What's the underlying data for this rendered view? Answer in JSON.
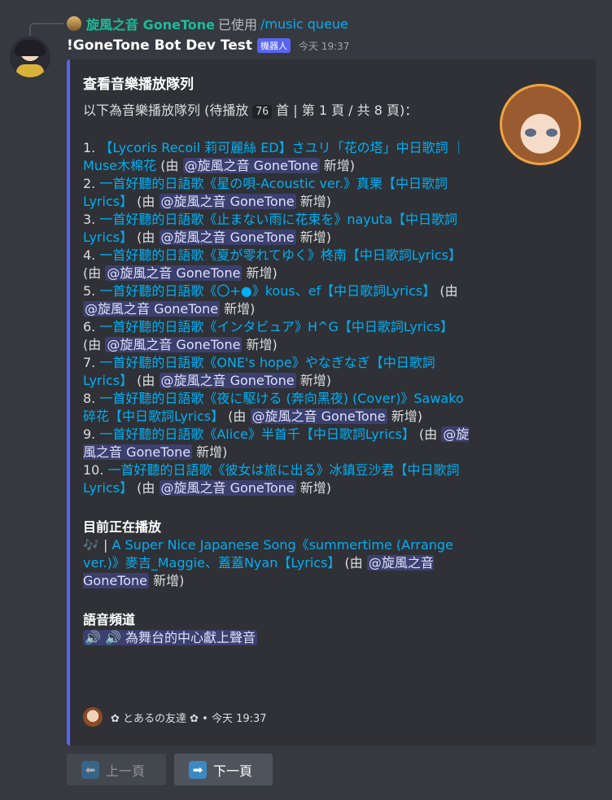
{
  "reply": {
    "user": "旋風之音 GoneTone",
    "used": "已使用",
    "command": "/music queue"
  },
  "message": {
    "bot_name": "!GoneTone Bot Dev Test",
    "bot_tag": "機器人",
    "timestamp": "今天 19:37"
  },
  "embed": {
    "title": "查看音樂播放隊列",
    "desc_prefix": "以下為音樂播放隊列 (待播放 ",
    "pending_count": "76",
    "desc_suffix": " 首 | 第 1 頁 / 共 8 頁)：",
    "mention_prefix": "@",
    "mention_name": "旋風之音 GoneTone",
    "added_by_open": "(由 ",
    "added_by_close": " 新增)",
    "queue": [
      {
        "num": "1.",
        "title": "【Lycoris Recoil 莉可麗絲 ED】さユリ「花の塔」中日歌詞 ｜Muse木棉花"
      },
      {
        "num": "2.",
        "title": "一首好聽的日語歌《星の唄-Acoustic ver.》真栗【中日歌詞Lyrics】"
      },
      {
        "num": "3.",
        "title": "一首好聽的日語歌《止まない雨に花束を》nayuta【中日歌詞Lyrics】"
      },
      {
        "num": "4.",
        "title": "一首好聽的日語歌《夏が零れてゆく》柊南【中日歌詞Lyrics】"
      },
      {
        "num": "5.",
        "title": "一首好聽的日語歌《〇+●》kous、ef【中日歌詞Lyrics】"
      },
      {
        "num": "6.",
        "title": "一首好聽的日語歌《インタビュア》H^G【中日歌詞Lyrics】"
      },
      {
        "num": "7.",
        "title": "一首好聽的日語歌《ONE's hope》やなぎなぎ【中日歌詞Lyrics】"
      },
      {
        "num": "8.",
        "title": "一首好聽的日語歌《夜に駆ける (奔向黑夜) (Cover)》Sawako碎花【中日歌詞Lyrics】"
      },
      {
        "num": "9.",
        "title": "一首好聽的日語歌《Alice》半首千【中日歌詞Lyrics】"
      },
      {
        "num": "10.",
        "title": "一首好聽的日語歌《彼女は旅に出る》冰鎮豆沙君【中日歌詞Lyrics】"
      }
    ],
    "now_playing_title": "目前正在播放",
    "now_playing_icon": "🎶",
    "now_playing_sep": " | ",
    "now_playing_song": "A Super Nice Japanese Song《summertime (Arrange ver.)》麥吉_Maggie、蓋蓋Nyan【Lyrics】",
    "voice_title": "語音頻道",
    "voice_channel": "🔊 🔊 為舞台的中心獻上聲音",
    "footer_text": "✿ とあるの友達 ✿ • 今天 19:37"
  },
  "buttons": {
    "prev_icon": "⬅",
    "prev_label": "上一頁",
    "next_icon": "➡",
    "next_label": "下一頁"
  },
  "colors": {
    "accent": "#5865f2",
    "link": "#00aff4",
    "reply_name": "#1abc9c",
    "background": "#36393f",
    "embed_bg": "#2f3136"
  }
}
